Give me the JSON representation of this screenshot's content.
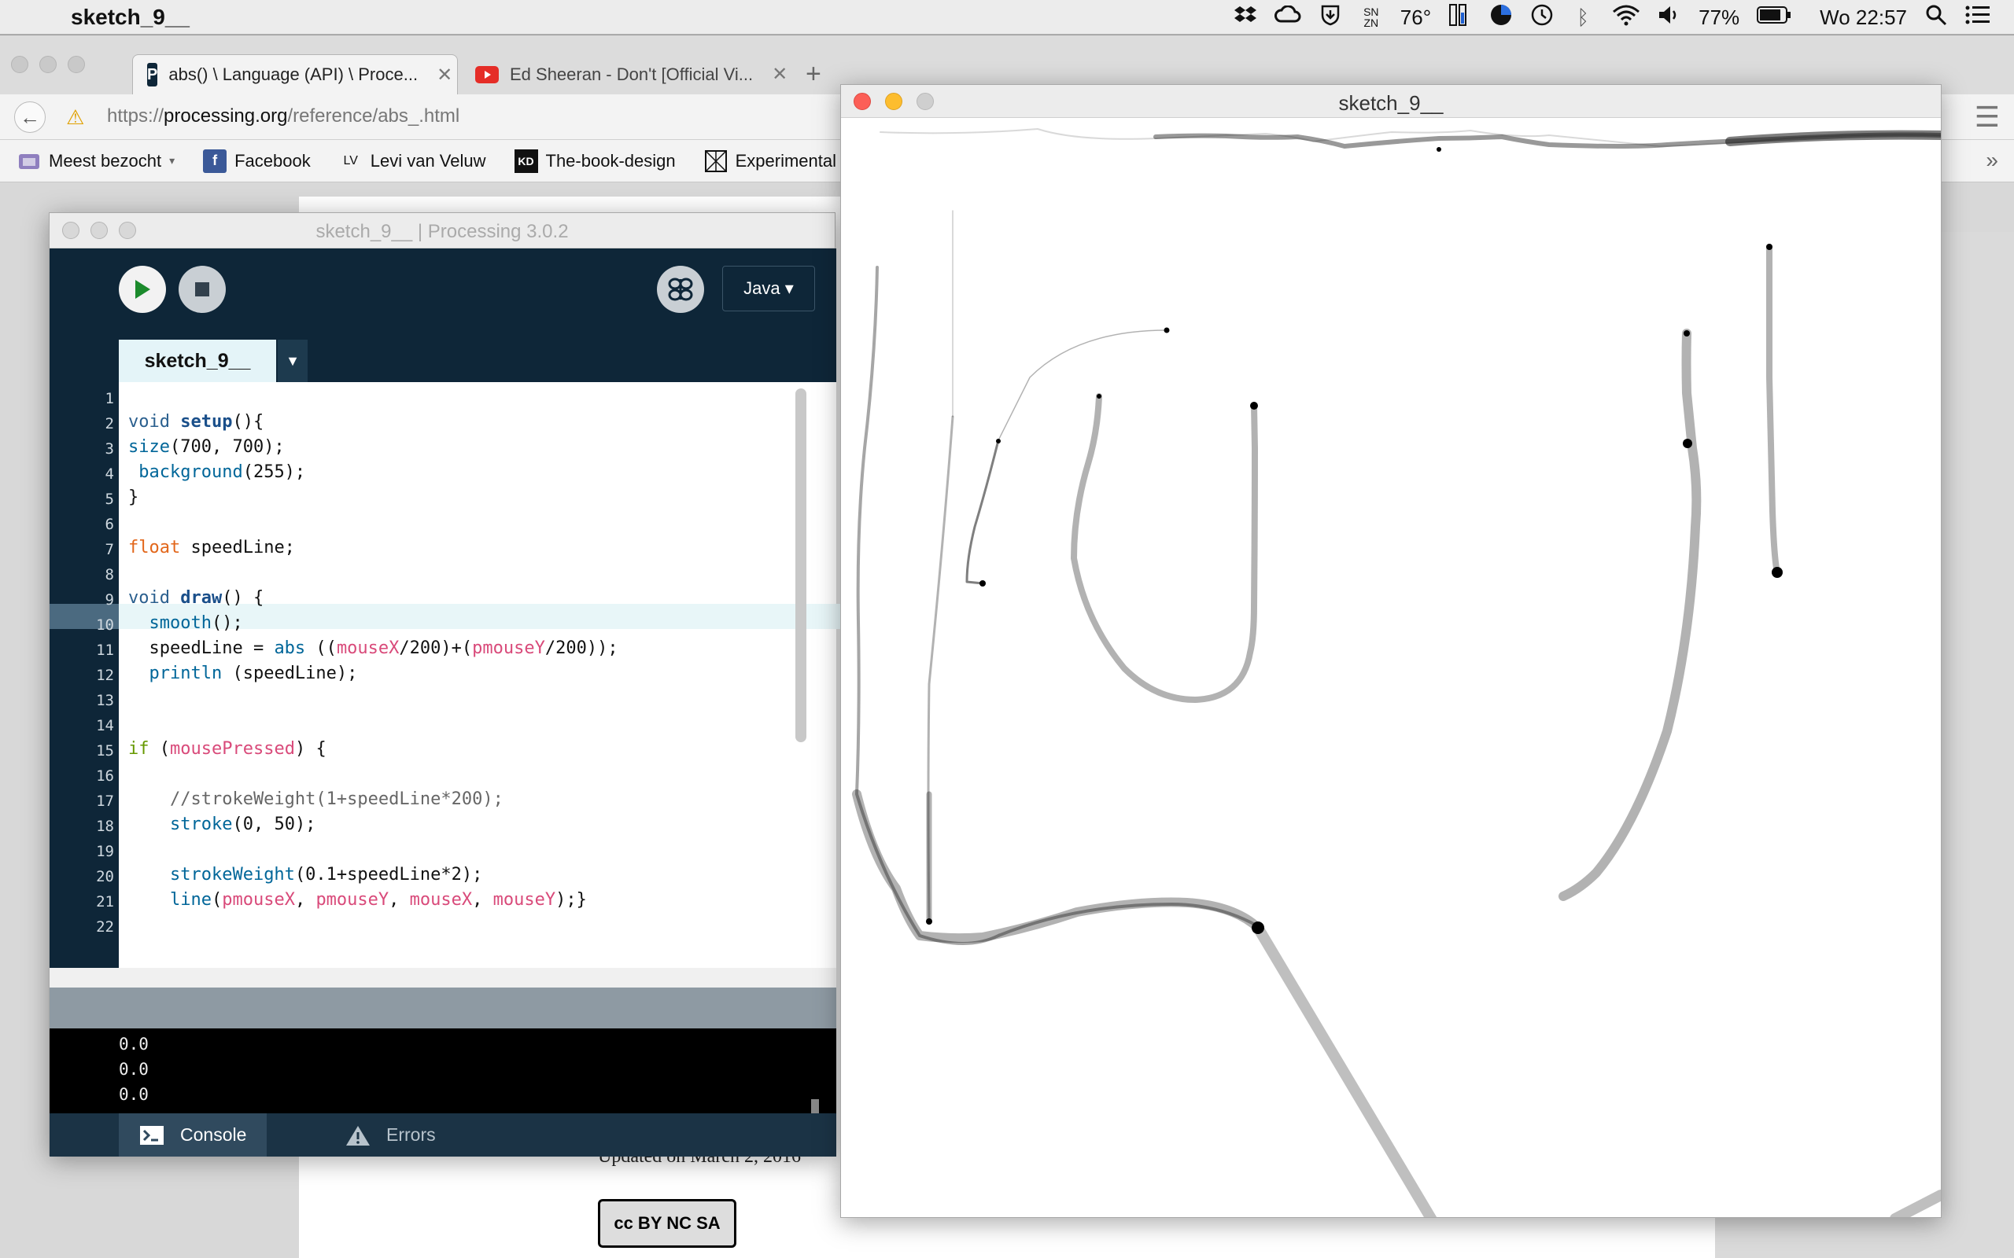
{
  "menubar": {
    "app_name": "sketch_9__",
    "temperature": "76°",
    "battery": "77%",
    "clock": "Wo 22:57"
  },
  "browser": {
    "tabs": [
      {
        "title": "abs() \\ Language (API) \\ Proce...",
        "favicon": "P",
        "active": true
      },
      {
        "title": "Ed Sheeran - Don't [Official Vi...",
        "favicon": "youtube-icon",
        "active": false
      }
    ],
    "url_prefix": "https://",
    "url_host": "processing.org",
    "url_path": "/reference/abs_.html",
    "bookmarks": [
      {
        "label": "Meest bezocht",
        "icon": "folder-icon"
      },
      {
        "label": "Facebook",
        "icon": "facebook-icon"
      },
      {
        "label": "Levi van Veluw",
        "icon": "LV"
      },
      {
        "label": "The-book-design",
        "icon": "book-icon"
      },
      {
        "label": "Experimental Je",
        "icon": "grid-icon"
      }
    ],
    "page_updated_text": "Updated on March 2, 2016",
    "license_badge": "cc BY NC SA"
  },
  "ide": {
    "window_title": "sketch_9__ | Processing 3.0.2",
    "mode": "Java ▾",
    "tab_name": "sketch_9__",
    "current_line": 10,
    "console_lines": [
      "0.0",
      "0.0",
      "0.0"
    ],
    "console_tab": "Console",
    "errors_tab": "Errors"
  },
  "sketch": {
    "window_title": "sketch_9__"
  },
  "colors": {
    "ide_dark": "#0e2638",
    "play_green": "#1b8a2c",
    "mac_red": "#fc5f57",
    "mac_yellow": "#fdbd2e",
    "mac_gray": "#cfcfcf"
  }
}
